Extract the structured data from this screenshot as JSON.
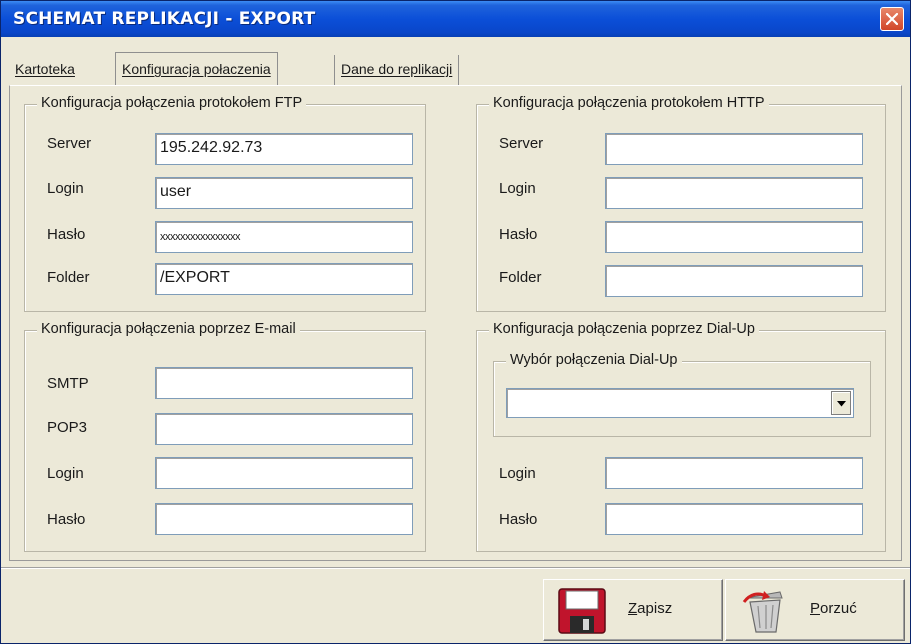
{
  "window": {
    "title": "SCHEMAT REPLIKACJI - EXPORT"
  },
  "tabs": [
    {
      "label": "Kartoteka",
      "active": false
    },
    {
      "label": "Konfiguracja połaczenia",
      "active": true
    },
    {
      "label": "Dane do replikacji",
      "active": false
    }
  ],
  "ftp": {
    "title": "Konfiguracja połączenia protokołem FTP",
    "server_label": "Server",
    "server_value": "195.242.92.73",
    "login_label": "Login",
    "login_value": "user",
    "password_label": "Hasło",
    "password_value": "xxxxxxxxxxxxxxxx",
    "folder_label": "Folder",
    "folder_value": "/EXPORT"
  },
  "http": {
    "title": "Konfiguracja połączenia protokołem HTTP",
    "server_label": "Server",
    "server_value": "",
    "login_label": "Login",
    "login_value": "",
    "password_label": "Hasło",
    "password_value": "",
    "folder_label": "Folder",
    "folder_value": ""
  },
  "email": {
    "title": "Konfiguracja połączenia poprzez E-mail",
    "smtp_label": "SMTP",
    "smtp_value": "",
    "pop3_label": "POP3",
    "pop3_value": "",
    "login_label": "Login",
    "login_value": "",
    "password_label": "Hasło",
    "password_value": ""
  },
  "dialup": {
    "title": "Konfiguracja połączenia poprzez Dial-Up",
    "choice_title": "Wybór połączenia Dial-Up",
    "choice_value": "",
    "login_label": "Login",
    "login_value": "",
    "password_label": "Hasło",
    "password_value": ""
  },
  "buttons": {
    "save_label": "Zapisz",
    "discard_label": "Porzuć"
  },
  "icons": {
    "save": "floppy-disk-icon",
    "discard": "trash-bin-icon",
    "close": "close-icon",
    "dropdown": "chevron-down-icon"
  }
}
